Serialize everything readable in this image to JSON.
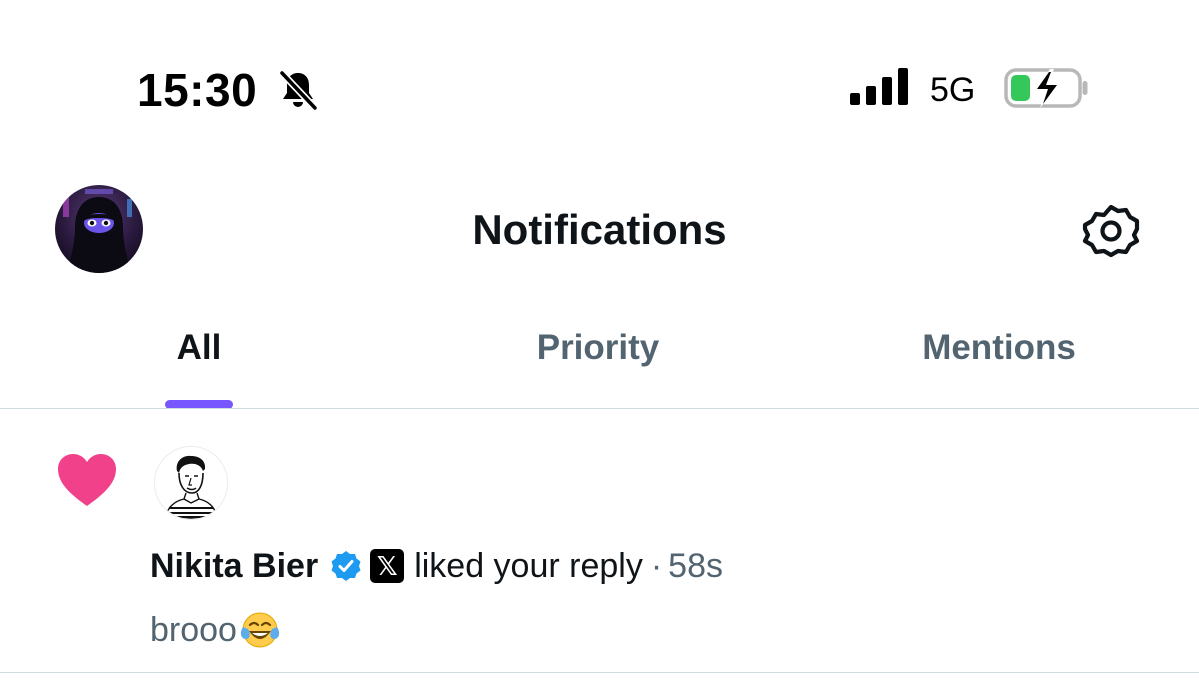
{
  "status_bar": {
    "time": "15:30",
    "network": "5G",
    "silent_icon": "bell-slash-icon",
    "signal_icon": "cellular-signal-icon",
    "battery_icon": "battery-charging-icon",
    "battery_color": "#34c759"
  },
  "header": {
    "title": "Notifications",
    "settings_icon": "gear-icon"
  },
  "tabs": [
    {
      "label": "All",
      "active": true
    },
    {
      "label": "Priority",
      "active": false
    },
    {
      "label": "Mentions",
      "active": false
    }
  ],
  "colors": {
    "accent": "#7856ff",
    "like": "#f91880",
    "verified": "#1d9bf0",
    "secondary_text": "#536471"
  },
  "notifications": [
    {
      "type_icon": "heart-icon",
      "user_name": "Nikita Bier",
      "verified": true,
      "affiliate_badge": "𝕏",
      "action": "liked your reply",
      "separator": "·",
      "time_ago": "58s",
      "snippet": "brooo",
      "snippet_emoji": "face-with-tears-of-joy-icon"
    }
  ]
}
